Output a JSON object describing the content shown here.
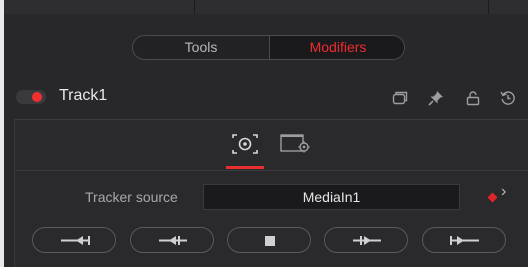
{
  "tabs": {
    "tools": "Tools",
    "modifiers": "Modifiers"
  },
  "node": {
    "name": "Track1",
    "enabled": true
  },
  "header_icons": [
    "stack-icon",
    "pin-icon",
    "lock-icon",
    "reset-icon"
  ],
  "inspector_tabs": [
    "tracker-target-icon",
    "tracker-settings-icon"
  ],
  "tracker": {
    "source_label": "Tracker source",
    "source_value": "MediaIn1"
  },
  "tracking_buttons": [
    "track-to-start",
    "track-backward",
    "stop-tracking",
    "track-forward",
    "track-to-end"
  ],
  "colors": {
    "accent": "#ee2b2f",
    "panel": "#28282b"
  }
}
